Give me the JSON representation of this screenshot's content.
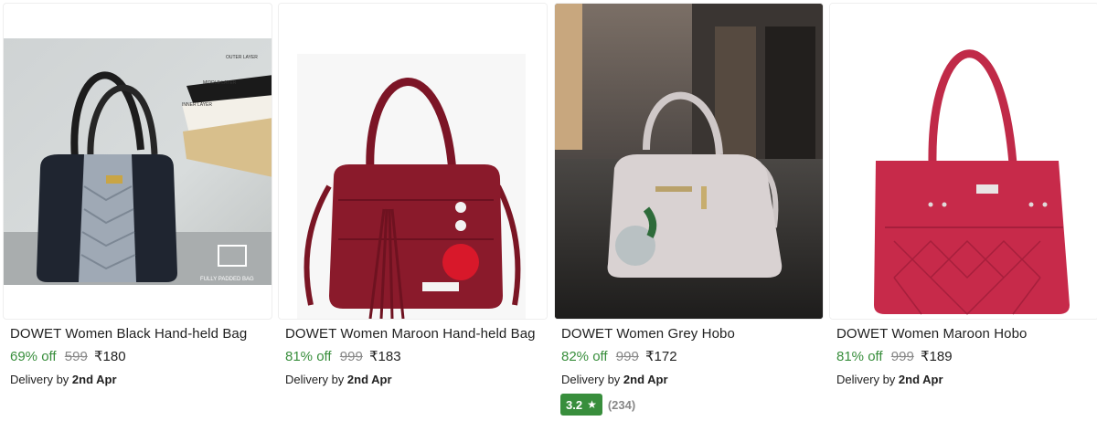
{
  "products": [
    {
      "title": "DOWET Women Black Hand-held Bag",
      "discount": "69% off",
      "mrp": "599",
      "price": "₹180",
      "delivery_prefix": "Delivery by",
      "delivery_date": "2nd Apr",
      "image_caption": "FULLY PADDED BAG",
      "layer_labels": [
        "OUTER LAYER",
        "MIDDLE LAYER",
        "INNER LAYER"
      ],
      "bag_color": "#1f2530"
    },
    {
      "title": "DOWET Women Maroon Hand-held Bag",
      "discount": "81% off",
      "mrp": "999",
      "price": "₹183",
      "delivery_prefix": "Delivery by",
      "delivery_date": "2nd Apr",
      "bag_color": "#8a1a2b"
    },
    {
      "title": "DOWET Women Grey Hobo",
      "discount": "82% off",
      "mrp": "999",
      "price": "₹172",
      "delivery_prefix": "Delivery by",
      "delivery_date": "2nd Apr",
      "rating": "3.2",
      "rating_count": "(234)",
      "bag_color": "#d9d2d2"
    },
    {
      "title": "DOWET Women Maroon Hobo",
      "discount": "81% off",
      "mrp": "999",
      "price": "₹189",
      "delivery_prefix": "Delivery by",
      "delivery_date": "2nd Apr",
      "bag_color": "#c72a4a"
    }
  ],
  "colors": {
    "discount_green": "#388e3c",
    "mrp_grey": "#878787",
    "text": "#212121",
    "rating_badge": "#388e3c"
  }
}
